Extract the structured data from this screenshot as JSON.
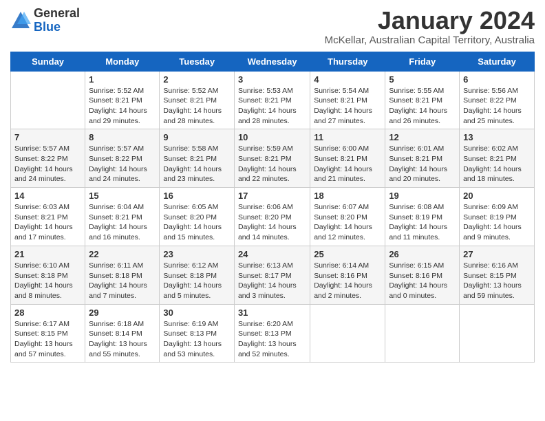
{
  "header": {
    "logo_line1": "General",
    "logo_line2": "Blue",
    "title": "January 2024",
    "subtitle": "McKellar, Australian Capital Territory, Australia"
  },
  "days_of_week": [
    "Sunday",
    "Monday",
    "Tuesday",
    "Wednesday",
    "Thursday",
    "Friday",
    "Saturday"
  ],
  "weeks": [
    [
      {
        "day": "",
        "info": ""
      },
      {
        "day": "1",
        "info": "Sunrise: 5:52 AM\nSunset: 8:21 PM\nDaylight: 14 hours\nand 29 minutes."
      },
      {
        "day": "2",
        "info": "Sunrise: 5:52 AM\nSunset: 8:21 PM\nDaylight: 14 hours\nand 28 minutes."
      },
      {
        "day": "3",
        "info": "Sunrise: 5:53 AM\nSunset: 8:21 PM\nDaylight: 14 hours\nand 28 minutes."
      },
      {
        "day": "4",
        "info": "Sunrise: 5:54 AM\nSunset: 8:21 PM\nDaylight: 14 hours\nand 27 minutes."
      },
      {
        "day": "5",
        "info": "Sunrise: 5:55 AM\nSunset: 8:21 PM\nDaylight: 14 hours\nand 26 minutes."
      },
      {
        "day": "6",
        "info": "Sunrise: 5:56 AM\nSunset: 8:22 PM\nDaylight: 14 hours\nand 25 minutes."
      }
    ],
    [
      {
        "day": "7",
        "info": "Sunrise: 5:57 AM\nSunset: 8:22 PM\nDaylight: 14 hours\nand 24 minutes."
      },
      {
        "day": "8",
        "info": "Sunrise: 5:57 AM\nSunset: 8:22 PM\nDaylight: 14 hours\nand 24 minutes."
      },
      {
        "day": "9",
        "info": "Sunrise: 5:58 AM\nSunset: 8:21 PM\nDaylight: 14 hours\nand 23 minutes."
      },
      {
        "day": "10",
        "info": "Sunrise: 5:59 AM\nSunset: 8:21 PM\nDaylight: 14 hours\nand 22 minutes."
      },
      {
        "day": "11",
        "info": "Sunrise: 6:00 AM\nSunset: 8:21 PM\nDaylight: 14 hours\nand 21 minutes."
      },
      {
        "day": "12",
        "info": "Sunrise: 6:01 AM\nSunset: 8:21 PM\nDaylight: 14 hours\nand 20 minutes."
      },
      {
        "day": "13",
        "info": "Sunrise: 6:02 AM\nSunset: 8:21 PM\nDaylight: 14 hours\nand 18 minutes."
      }
    ],
    [
      {
        "day": "14",
        "info": "Sunrise: 6:03 AM\nSunset: 8:21 PM\nDaylight: 14 hours\nand 17 minutes."
      },
      {
        "day": "15",
        "info": "Sunrise: 6:04 AM\nSunset: 8:21 PM\nDaylight: 14 hours\nand 16 minutes."
      },
      {
        "day": "16",
        "info": "Sunrise: 6:05 AM\nSunset: 8:20 PM\nDaylight: 14 hours\nand 15 minutes."
      },
      {
        "day": "17",
        "info": "Sunrise: 6:06 AM\nSunset: 8:20 PM\nDaylight: 14 hours\nand 14 minutes."
      },
      {
        "day": "18",
        "info": "Sunrise: 6:07 AM\nSunset: 8:20 PM\nDaylight: 14 hours\nand 12 minutes."
      },
      {
        "day": "19",
        "info": "Sunrise: 6:08 AM\nSunset: 8:19 PM\nDaylight: 14 hours\nand 11 minutes."
      },
      {
        "day": "20",
        "info": "Sunrise: 6:09 AM\nSunset: 8:19 PM\nDaylight: 14 hours\nand 9 minutes."
      }
    ],
    [
      {
        "day": "21",
        "info": "Sunrise: 6:10 AM\nSunset: 8:18 PM\nDaylight: 14 hours\nand 8 minutes."
      },
      {
        "day": "22",
        "info": "Sunrise: 6:11 AM\nSunset: 8:18 PM\nDaylight: 14 hours\nand 7 minutes."
      },
      {
        "day": "23",
        "info": "Sunrise: 6:12 AM\nSunset: 8:18 PM\nDaylight: 14 hours\nand 5 minutes."
      },
      {
        "day": "24",
        "info": "Sunrise: 6:13 AM\nSunset: 8:17 PM\nDaylight: 14 hours\nand 3 minutes."
      },
      {
        "day": "25",
        "info": "Sunrise: 6:14 AM\nSunset: 8:16 PM\nDaylight: 14 hours\nand 2 minutes."
      },
      {
        "day": "26",
        "info": "Sunrise: 6:15 AM\nSunset: 8:16 PM\nDaylight: 14 hours\nand 0 minutes."
      },
      {
        "day": "27",
        "info": "Sunrise: 6:16 AM\nSunset: 8:15 PM\nDaylight: 13 hours\nand 59 minutes."
      }
    ],
    [
      {
        "day": "28",
        "info": "Sunrise: 6:17 AM\nSunset: 8:15 PM\nDaylight: 13 hours\nand 57 minutes."
      },
      {
        "day": "29",
        "info": "Sunrise: 6:18 AM\nSunset: 8:14 PM\nDaylight: 13 hours\nand 55 minutes."
      },
      {
        "day": "30",
        "info": "Sunrise: 6:19 AM\nSunset: 8:13 PM\nDaylight: 13 hours\nand 53 minutes."
      },
      {
        "day": "31",
        "info": "Sunrise: 6:20 AM\nSunset: 8:13 PM\nDaylight: 13 hours\nand 52 minutes."
      },
      {
        "day": "",
        "info": ""
      },
      {
        "day": "",
        "info": ""
      },
      {
        "day": "",
        "info": ""
      }
    ]
  ]
}
